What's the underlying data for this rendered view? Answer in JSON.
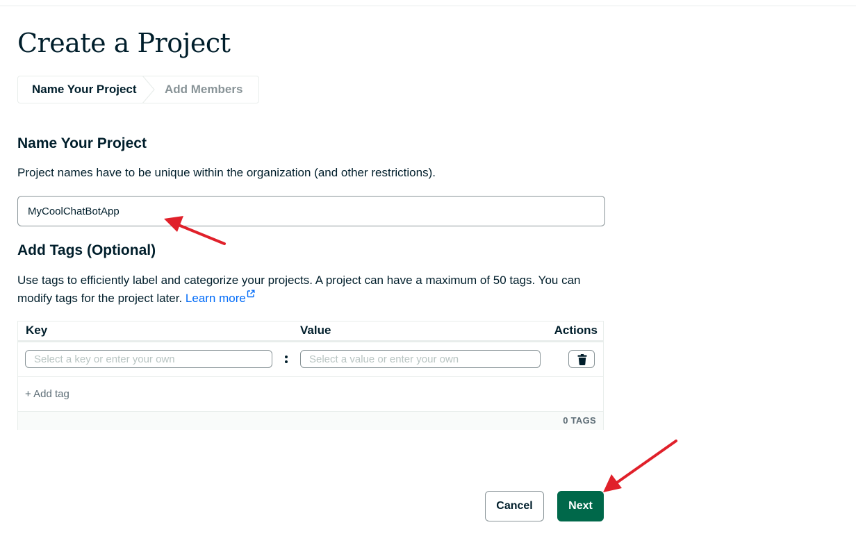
{
  "page": {
    "title": "Create a Project"
  },
  "stepper": {
    "steps": [
      {
        "label": "Name Your Project",
        "active": true
      },
      {
        "label": "Add Members",
        "active": false
      }
    ]
  },
  "name_section": {
    "heading": "Name Your Project",
    "description": "Project names have to be unique within the organization (and other restrictions).",
    "input_value": "MyCoolChatBotApp"
  },
  "tags_section": {
    "heading": "Add Tags (Optional)",
    "description": "Use tags to efficiently label and categorize your projects. A project can have a maximum of 50 tags. You can modify tags for the project later.",
    "learn_more_label": "Learn more",
    "table": {
      "columns": [
        "Key",
        "Value",
        "Actions"
      ],
      "key_placeholder": "Select a key or enter your own",
      "value_placeholder": "Select a value or enter your own",
      "add_tag_label": "+ Add tag",
      "tag_count": "0 TAGS"
    }
  },
  "footer": {
    "cancel_label": "Cancel",
    "next_label": "Next"
  },
  "colors": {
    "primary_button": "#00684a",
    "link": "#016bf8",
    "annotation_arrow": "#e0202a",
    "text": "#001e2b"
  },
  "icons": {
    "external_link": "external-link-icon",
    "trash": "trash-icon",
    "step_chevron": "chevron-right-icon"
  }
}
